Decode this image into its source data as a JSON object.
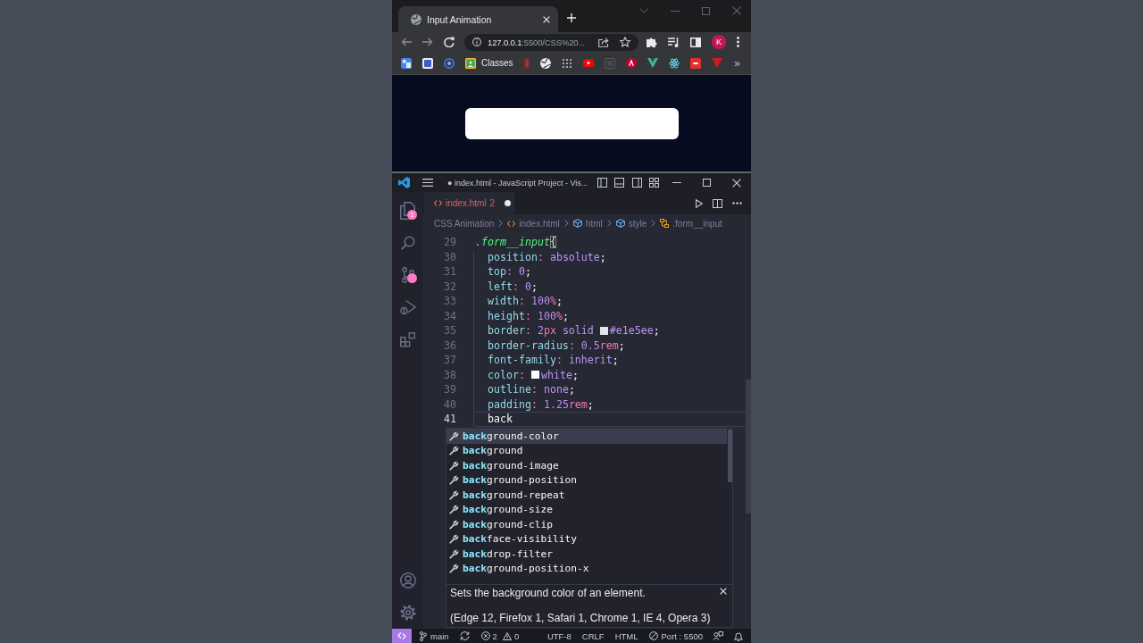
{
  "browser": {
    "tabs": [
      {
        "title": "Input Animation",
        "selected": true
      }
    ],
    "address": {
      "host": "127.0.0.1",
      "path": ":5500/CSS%20..."
    },
    "profile_initial": "K",
    "bookmarks": [
      {
        "label": "Classes"
      }
    ],
    "bookmarks_overflow": "»"
  },
  "editor_window": {
    "title": "● index.html - JavaScript Project - Vis...",
    "activity_bar": {
      "top": [
        {
          "kind": "explorer",
          "badge": "1",
          "badge_dot": false
        },
        {
          "kind": "search",
          "badge_dot": false
        },
        {
          "kind": "source-control",
          "badge_dot": true
        },
        {
          "kind": "run-debug",
          "badge_dot": false
        },
        {
          "kind": "extensions",
          "badge_dot": false
        }
      ],
      "bottom": [
        {
          "kind": "accounts"
        },
        {
          "kind": "manage"
        }
      ]
    },
    "tabs": [
      {
        "label": "index.html",
        "problems": "2",
        "modified": true,
        "selected": true
      }
    ],
    "breadcrumbs": [
      {
        "kind": "folder",
        "label": "CSS Animation"
      },
      {
        "kind": "file",
        "label": "index.html"
      },
      {
        "kind": "element",
        "label": "html"
      },
      {
        "kind": "element",
        "label": "style"
      },
      {
        "kind": "rule",
        "label": ".form__input"
      }
    ],
    "code_lines": [
      {
        "number": "29",
        "current": false,
        "tokens": [
          {
            "kind": "selector",
            "text": ".form__input"
          },
          {
            "kind": "brace",
            "text": "{"
          }
        ],
        "children": [
          {
            "number": "30",
            "current": false,
            "tokens": [
              {
                "kind": "property",
                "text": "position"
              },
              {
                "kind": "colon",
                "text": ": "
              },
              {
                "kind": "value",
                "text": "absolute"
              },
              {
                "kind": "semicolon",
                "text": ";"
              }
            ]
          },
          {
            "number": "31",
            "current": false,
            "tokens": [
              {
                "kind": "property",
                "text": "top"
              },
              {
                "kind": "colon",
                "text": ": "
              },
              {
                "kind": "number",
                "text": "0"
              },
              {
                "kind": "semicolon",
                "text": ";"
              }
            ]
          },
          {
            "number": "32",
            "current": false,
            "tokens": [
              {
                "kind": "property",
                "text": "left"
              },
              {
                "kind": "colon",
                "text": ": "
              },
              {
                "kind": "number",
                "text": "0"
              },
              {
                "kind": "semicolon",
                "text": ";"
              }
            ]
          },
          {
            "number": "33",
            "current": false,
            "tokens": [
              {
                "kind": "property",
                "text": "width"
              },
              {
                "kind": "colon",
                "text": ": "
              },
              {
                "kind": "number",
                "text": "100"
              },
              {
                "kind": "unit",
                "text": "%"
              },
              {
                "kind": "semicolon",
                "text": ";"
              }
            ]
          },
          {
            "number": "34",
            "current": false,
            "tokens": [
              {
                "kind": "property",
                "text": "height"
              },
              {
                "kind": "colon",
                "text": ": "
              },
              {
                "kind": "number",
                "text": "100"
              },
              {
                "kind": "unit",
                "text": "%"
              },
              {
                "kind": "semicolon",
                "text": ";"
              }
            ]
          },
          {
            "number": "35",
            "current": false,
            "tokens": [
              {
                "kind": "property",
                "text": "border"
              },
              {
                "kind": "colon",
                "text": ": "
              },
              {
                "kind": "number",
                "text": "2"
              },
              {
                "kind": "unit",
                "text": "px"
              },
              {
                "kind": "value",
                "text": " solid"
              },
              {
                "kind": "swatch",
                "color": "#e1e5ee"
              },
              {
                "kind": "value",
                "text": "#e1e5ee"
              },
              {
                "kind": "semicolon",
                "text": ";"
              }
            ]
          },
          {
            "number": "36",
            "current": false,
            "tokens": [
              {
                "kind": "property",
                "text": "border-radius"
              },
              {
                "kind": "colon",
                "text": ": "
              },
              {
                "kind": "number",
                "text": "0.5"
              },
              {
                "kind": "unit",
                "text": "rem"
              },
              {
                "kind": "semicolon",
                "text": ";"
              }
            ]
          },
          {
            "number": "37",
            "current": false,
            "tokens": [
              {
                "kind": "property",
                "text": "font-family"
              },
              {
                "kind": "colon",
                "text": ": "
              },
              {
                "kind": "value",
                "text": "inherit"
              },
              {
                "kind": "semicolon",
                "text": ";"
              }
            ]
          },
          {
            "number": "38",
            "current": false,
            "tokens": [
              {
                "kind": "property",
                "text": "color"
              },
              {
                "kind": "colon",
                "text": ":"
              },
              {
                "kind": "swatch",
                "color": "#ffffff"
              },
              {
                "kind": "value",
                "text": "white"
              },
              {
                "kind": "semicolon",
                "text": ";"
              }
            ]
          },
          {
            "number": "39",
            "current": false,
            "tokens": [
              {
                "kind": "property",
                "text": "outline"
              },
              {
                "kind": "colon",
                "text": ": "
              },
              {
                "kind": "value",
                "text": "none"
              },
              {
                "kind": "semicolon",
                "text": ";"
              }
            ]
          },
          {
            "number": "40",
            "current": false,
            "tokens": [
              {
                "kind": "property",
                "text": "padding"
              },
              {
                "kind": "colon",
                "text": ": "
              },
              {
                "kind": "number",
                "text": "1.25"
              },
              {
                "kind": "unit",
                "text": "rem"
              },
              {
                "kind": "semicolon",
                "text": ";"
              }
            ]
          },
          {
            "number": "41",
            "current": true,
            "tokens": [
              {
                "kind": "text",
                "text": "back"
              }
            ]
          }
        ]
      }
    ],
    "suggestions": [
      {
        "match": "back",
        "rest": "ground-color",
        "selected": true
      },
      {
        "match": "back",
        "rest": "ground",
        "selected": false
      },
      {
        "match": "back",
        "rest": "ground-image",
        "selected": false
      },
      {
        "match": "back",
        "rest": "ground-position",
        "selected": false
      },
      {
        "match": "back",
        "rest": "ground-repeat",
        "selected": false
      },
      {
        "match": "back",
        "rest": "ground-size",
        "selected": false
      },
      {
        "match": "back",
        "rest": "ground-clip",
        "selected": false
      },
      {
        "match": "back",
        "rest": "face-visibility",
        "selected": false
      },
      {
        "match": "back",
        "rest": "drop-filter",
        "selected": false
      },
      {
        "match": "back",
        "rest": "ground-position-x",
        "selected": false
      }
    ],
    "suggestion_details": {
      "description": "Sets the background color of an element.",
      "compatibility": "(Edge 12, Firefox 1, Safari 1, Chrome 1, IE 4, Opera 3)"
    },
    "status_bar": {
      "branch": "main",
      "errors": "2",
      "warnings": "0",
      "encoding": "UTF-8",
      "line_ending": "CRLF",
      "language": "HTML",
      "port": "Port : 5500"
    }
  }
}
